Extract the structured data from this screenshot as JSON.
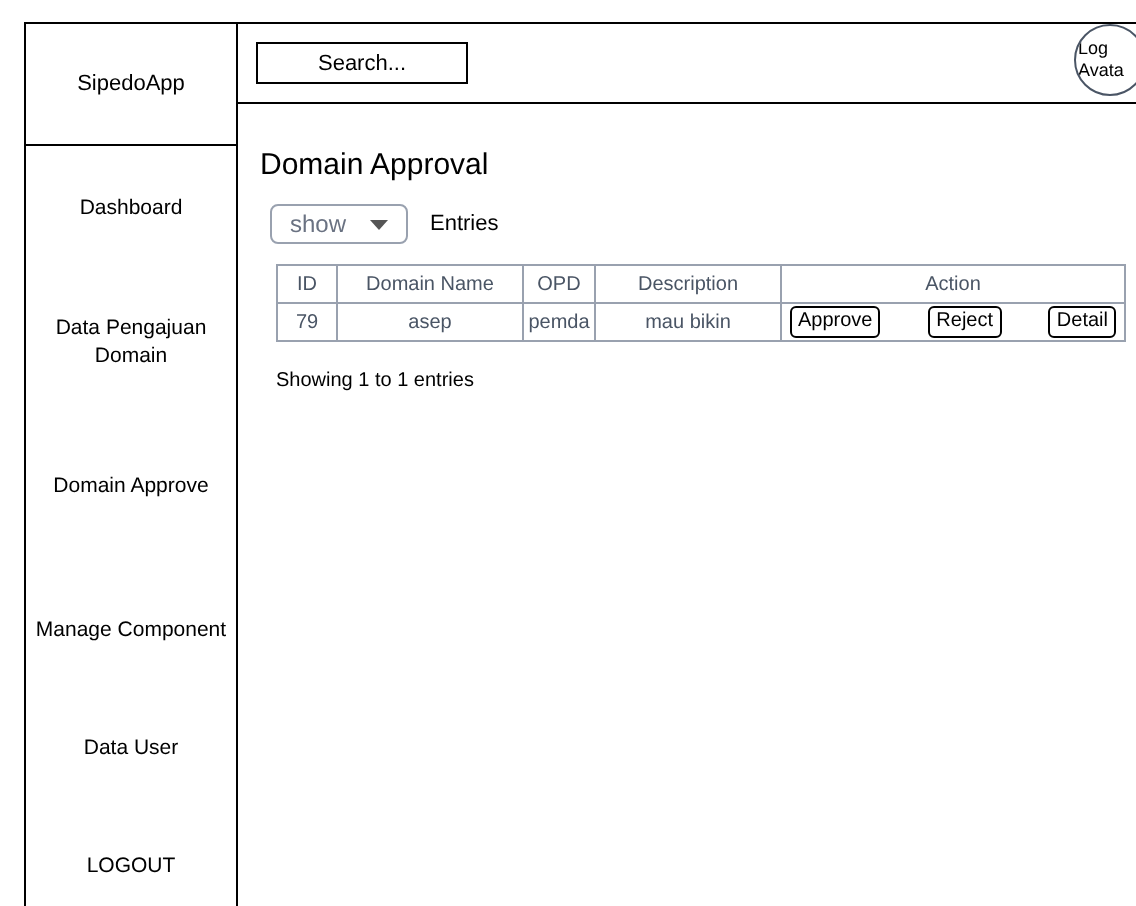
{
  "app_name": "SipedoApp",
  "search": {
    "placeholder": "Search..."
  },
  "avatar": {
    "lines": [
      "Log",
      "Avata"
    ]
  },
  "sidebar": {
    "items": [
      {
        "label": "Dashboard"
      },
      {
        "label": "Data Pengajuan Domain"
      },
      {
        "label": "Domain Approve"
      },
      {
        "label": "Manage Component"
      },
      {
        "label": "Data User"
      },
      {
        "label": "LOGOUT"
      }
    ]
  },
  "page_title": "Domain Approval",
  "entries": {
    "select": "show",
    "label": "Entries"
  },
  "table": {
    "columns": [
      "ID",
      "Domain Name",
      "OPD",
      "Description",
      "Action"
    ],
    "rows": [
      {
        "cells": [
          "79",
          "asep",
          "pemda",
          "mau bikin"
        ],
        "actions": [
          "Approve",
          "Reject",
          "Detail"
        ]
      }
    ]
  },
  "footer": "Showing 1 to 1 entries"
}
